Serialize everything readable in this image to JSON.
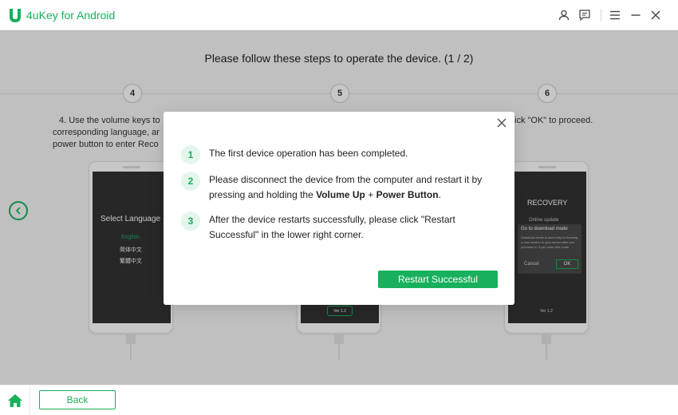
{
  "app": {
    "title": "4uKey for Android",
    "brand_color": "#18b05d"
  },
  "titlebar_icons": [
    "user-icon",
    "feedback-icon",
    "menu-icon",
    "minimize-icon",
    "close-icon"
  ],
  "main": {
    "instruction": "Please follow these steps to operate the device. (1 / 2)",
    "steps": [
      {
        "number": "4",
        "text_line1": "4. Use the volume keys to",
        "text_line2": "corresponding language, ar",
        "text_line3": "power button to enter Reco"
      },
      {
        "number": "5"
      },
      {
        "number": "6",
        "text_right": "ick \"OK\" to proceed."
      }
    ],
    "phone_left": {
      "title": "Select Language",
      "options": [
        "English",
        "简体中文",
        "繁體中文"
      ]
    },
    "phone_middle": {
      "badge": "Ver 1.2"
    },
    "phone_right": {
      "title": "RECOVERY",
      "subtitle": "Online update",
      "dialog_title": "Go to download mode",
      "dialog_body": "Download mode is used only for booting a new version to your device after you purchase it. If you enter this mode",
      "cancel": "Cancel",
      "ok": "OK",
      "badge": "Ver 1.2"
    }
  },
  "modal": {
    "steps": [
      {
        "number": "1",
        "text": "The first device operation has been completed."
      },
      {
        "number": "2",
        "text_before": "Please disconnect the device from the computer and restart it by pressing and holding the ",
        "bold1": "Volume Up",
        "plus": " + ",
        "bold2": "Power Button",
        "text_after": "."
      },
      {
        "number": "3",
        "text": "After the device restarts successfully, please click \"Restart Successful\" in the lower right corner."
      }
    ],
    "button_label": "Restart Successful"
  },
  "bottom": {
    "back_label": "Back"
  }
}
